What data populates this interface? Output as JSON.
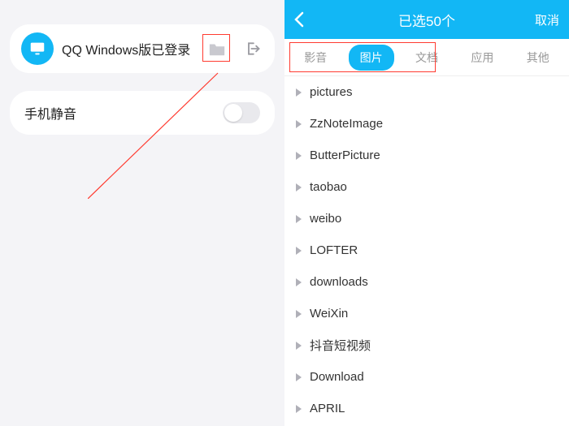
{
  "left": {
    "login_card": {
      "text": "QQ Windows版已登录"
    },
    "mute_card": {
      "label": "手机静音",
      "toggle_on": false
    }
  },
  "right": {
    "header": {
      "title": "已选50个",
      "cancel": "取消"
    },
    "tabs": [
      {
        "label": "影音",
        "active": false
      },
      {
        "label": "图片",
        "active": true
      },
      {
        "label": "文档",
        "active": false
      },
      {
        "label": "应用",
        "active": false
      },
      {
        "label": "其他",
        "active": false
      }
    ],
    "folders": [
      "pictures",
      "ZzNoteImage",
      "ButterPicture",
      "taobao",
      "weibo",
      "LOFTER",
      "downloads",
      "WeiXin",
      "抖音短视频",
      "Download",
      "APRIL"
    ]
  }
}
